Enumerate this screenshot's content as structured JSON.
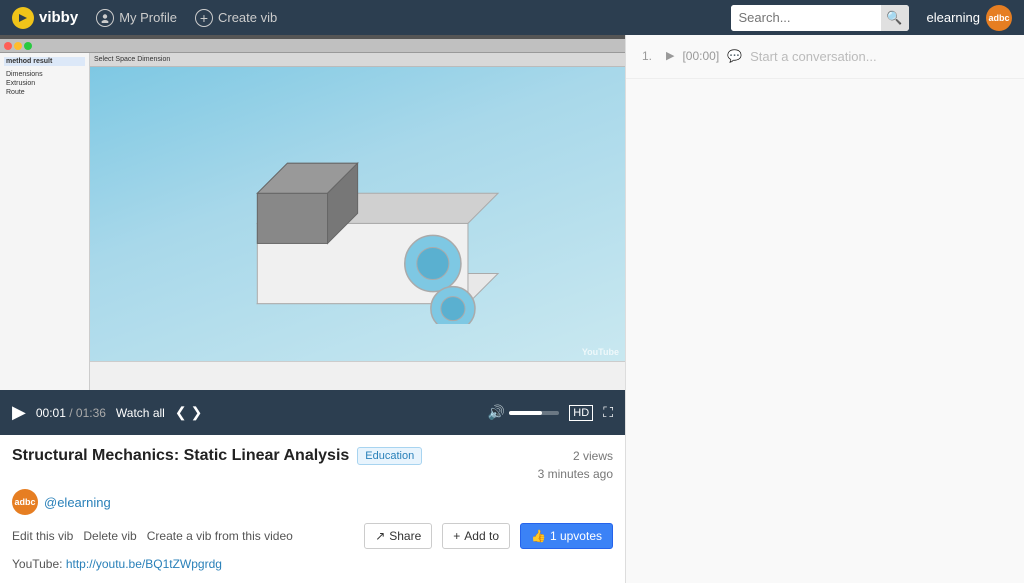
{
  "nav": {
    "logo_text": "vibby",
    "logo_icon_text": "v",
    "profile_label": "My Profile",
    "create_label": "Create vib",
    "search_placeholder": "Search...",
    "search_icon": "🔍",
    "user_label": "elearning",
    "user_avatar_text": "adbc"
  },
  "video": {
    "title": "Structural Mechanics: Static Linear Analysis",
    "tag": "Education",
    "views": "2 views",
    "time_ago": "3 minutes ago",
    "current_time": "00:01",
    "total_time": "01:36",
    "watch_all_label": "Watch all",
    "hd_label": "HD",
    "author_handle": "@elearning",
    "author_avatar": "adbc",
    "edit_vib_label": "Edit this vib",
    "delete_vib_label": "Delete vib",
    "create_from_video_label": "Create a vib from this video",
    "share_label": "Share",
    "add_to_label": "Add to",
    "upvotes_label": "1 upvotes",
    "youtube_label": "YouTube:",
    "youtube_url": "http://youtu.be/BQ1tZWpgrdg",
    "youtube_watermark": "YouTube"
  },
  "comments": {
    "item": {
      "index": "1.",
      "timestamp": "[00:00]",
      "placeholder": "Start a conversation..."
    }
  },
  "cad": {
    "select_space_label": "Select Space Dimension",
    "sidebar_items": [
      "method result",
      "Dimensions",
      "Extrusion",
      "Route"
    ]
  }
}
